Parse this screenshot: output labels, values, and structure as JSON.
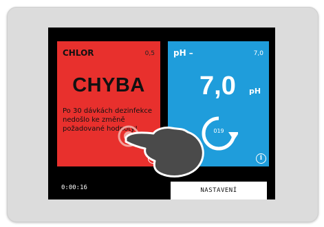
{
  "chlor_panel": {
    "title": "CHLOR",
    "setpoint": "0,5",
    "status": "CHYBA",
    "message": "Po 30 dávkách dezinfekce nedošlo ke změně požadované hodnoty!",
    "color": "#e8302d"
  },
  "ph_panel": {
    "title": "pH –",
    "setpoint": "7,0",
    "value": "7,0",
    "unit": "pH",
    "cycle_count": "019",
    "color": "#1f9ddb"
  },
  "info_icon": "i",
  "footer": {
    "timer": "0:00:16",
    "settings_label": "NASTAVENÍ"
  },
  "icons": [
    "info-icon",
    "refresh-cycle-icon",
    "tap-hand-icon"
  ]
}
